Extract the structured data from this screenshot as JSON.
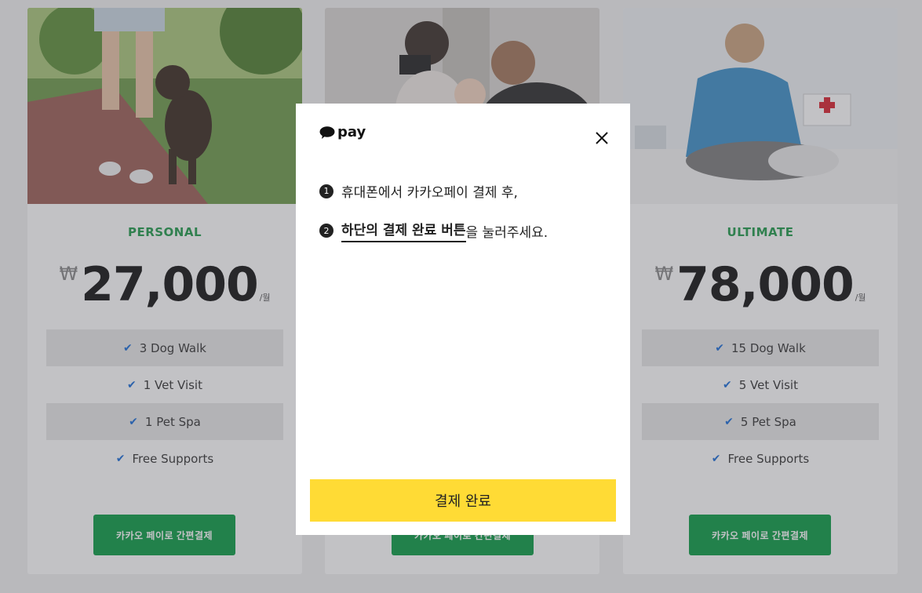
{
  "plans": [
    {
      "name": "PERSONAL",
      "currency": "₩",
      "price": "27,000",
      "per": "/월",
      "features": [
        "3 Dog Walk",
        "1 Vet Visit",
        "1 Pet Spa",
        "Free Supports"
      ],
      "button": "카카오 페이로 간편결제"
    },
    {
      "name": "",
      "currency": "",
      "price": "",
      "per": "",
      "features": [],
      "button": "카카오 페이로 간편결제"
    },
    {
      "name": "ULTIMATE",
      "currency": "₩",
      "price": "78,000",
      "per": "/월",
      "features": [
        "15 Dog Walk",
        "5 Vet Visit",
        "5 Pet Spa",
        "Free Supports"
      ],
      "button": "카카오 페이로 간편결제"
    }
  ],
  "modal": {
    "logo_text": "pay",
    "check_icon": "✔",
    "step1_num": "1",
    "step1_text": "휴대폰에서 카카오페이 결제 후,",
    "step2_num": "2",
    "step2_strong": "하단의 결제 완료 버튼",
    "step2_rest": "을 눌러주세요.",
    "confirm_button": "결제 완료"
  },
  "colors": {
    "plan_accent": "#1f9a4a",
    "pay_button": "#0a9b44",
    "check": "#1a6cd8",
    "kakao_yellow": "#ffdb35"
  }
}
